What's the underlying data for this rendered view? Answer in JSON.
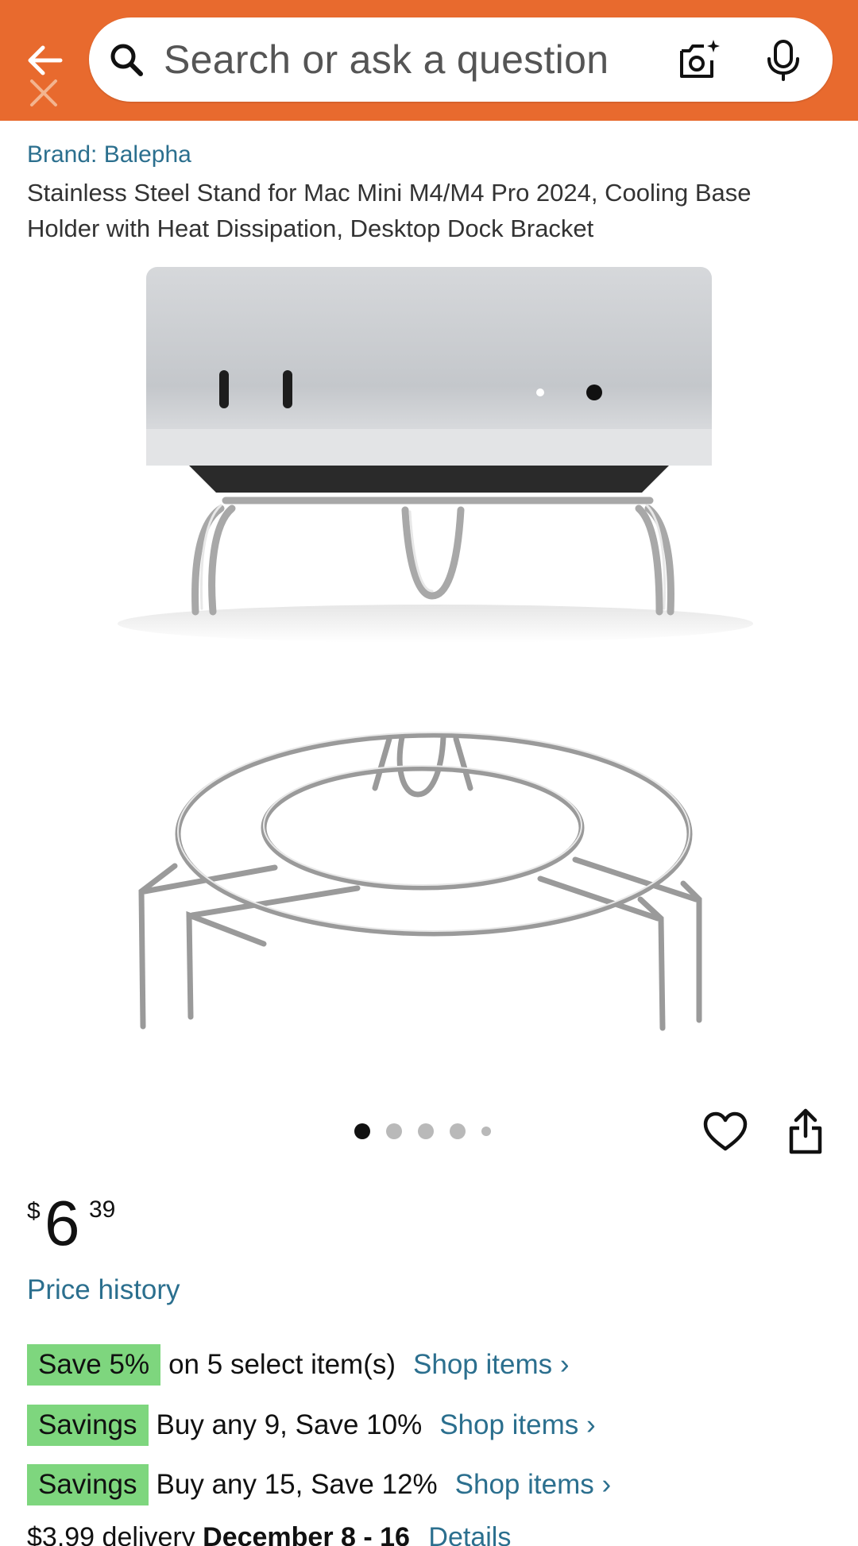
{
  "header": {
    "search_placeholder": "Search or ask a question",
    "accent_color": "#e86a2e",
    "icons": [
      "back-arrow-icon",
      "search-icon",
      "camera-icon",
      "microphone-icon"
    ]
  },
  "product": {
    "brand": "Brand: Balepha",
    "title": "Stainless Steel Stand for Mac Mini M4/M4 Pro 2024, Cooling Base Holder with Heat Dissipation, Desktop Dock Bracket",
    "image_count": 5,
    "active_image": 1
  },
  "price": {
    "symbol": "$",
    "whole": "6",
    "fraction": "39",
    "history_link": "Price history"
  },
  "savings": [
    {
      "badge": "Save 5%",
      "text": "on 5 select item(s)",
      "link": "Shop items ›"
    },
    {
      "badge": "Savings",
      "text": "Buy any 9, Save 10%",
      "link": "Shop items ›"
    },
    {
      "badge": "Savings",
      "text": "Buy any 15, Save 12%",
      "link": "Shop items ›"
    }
  ],
  "delivery": {
    "text": "$3.99 delivery",
    "date": "December 8 - 16",
    "link": "Details"
  },
  "colors": {
    "link": "#2b6f8e",
    "badge": "#7ed67e"
  }
}
